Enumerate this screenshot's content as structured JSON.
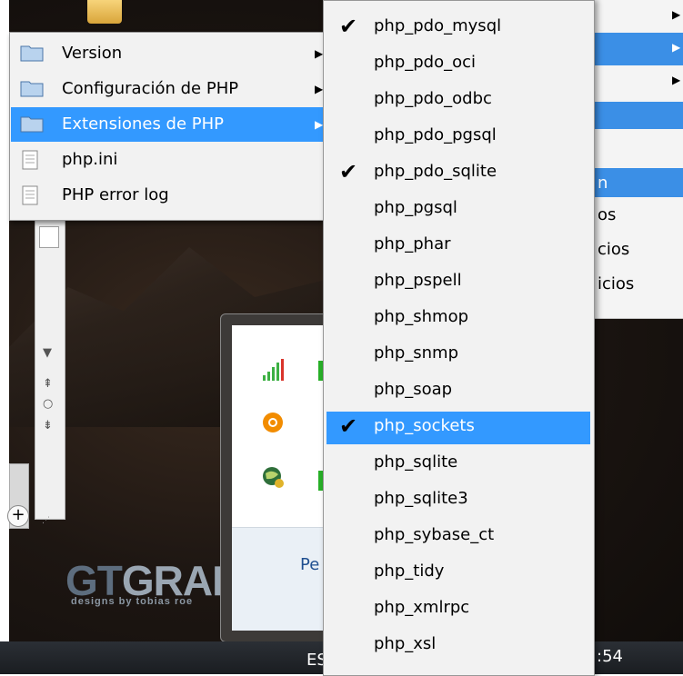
{
  "context_menu": {
    "items": [
      {
        "label": "Version",
        "icon": "folder-icon",
        "has_submenu": true
      },
      {
        "label": "Configuración de PHP",
        "icon": "folder-icon",
        "has_submenu": true
      },
      {
        "label": "Extensiones de PHP",
        "icon": "folder-icon",
        "has_submenu": true,
        "selected": true
      },
      {
        "label": "php.ini",
        "icon": "document-icon",
        "has_submenu": false
      },
      {
        "label": "PHP error log",
        "icon": "document-icon",
        "has_submenu": false
      }
    ]
  },
  "extensions_menu": {
    "items": [
      {
        "label": "php_pdo_mysql",
        "checked": true
      },
      {
        "label": "php_pdo_oci",
        "checked": false
      },
      {
        "label": "php_pdo_odbc",
        "checked": false
      },
      {
        "label": "php_pdo_pgsql",
        "checked": false
      },
      {
        "label": "php_pdo_sqlite",
        "checked": true
      },
      {
        "label": "php_pgsql",
        "checked": false
      },
      {
        "label": "php_phar",
        "checked": false
      },
      {
        "label": "php_pspell",
        "checked": false
      },
      {
        "label": "php_shmop",
        "checked": false
      },
      {
        "label": "php_snmp",
        "checked": false
      },
      {
        "label": "php_soap",
        "checked": false
      },
      {
        "label": "php_sockets",
        "checked": true,
        "selected": true
      },
      {
        "label": "php_sqlite",
        "checked": false
      },
      {
        "label": "php_sqlite3",
        "checked": false
      },
      {
        "label": "php_sybase_ct",
        "checked": false
      },
      {
        "label": "php_tidy",
        "checked": false
      },
      {
        "label": "php_xmlrpc",
        "checked": false
      },
      {
        "label": "php_xsl",
        "checked": false
      }
    ],
    "check_glyph": "✔"
  },
  "background_menu": {
    "items": [
      {
        "label": "n",
        "selected": true
      },
      {
        "label": "os"
      },
      {
        "label": "cios"
      },
      {
        "label": "icios"
      }
    ]
  },
  "tray_popup": {
    "footer_text": "Pe"
  },
  "desktop": {
    "logo_prefix": "GT",
    "logo_rest": "GRAF",
    "logo_subtitle": "designs by tobias roe"
  },
  "taskbar": {
    "language": "ES",
    "clock": ":54"
  },
  "colors": {
    "selection": "#3399ff",
    "menu_bg": "#f2f2f2"
  }
}
